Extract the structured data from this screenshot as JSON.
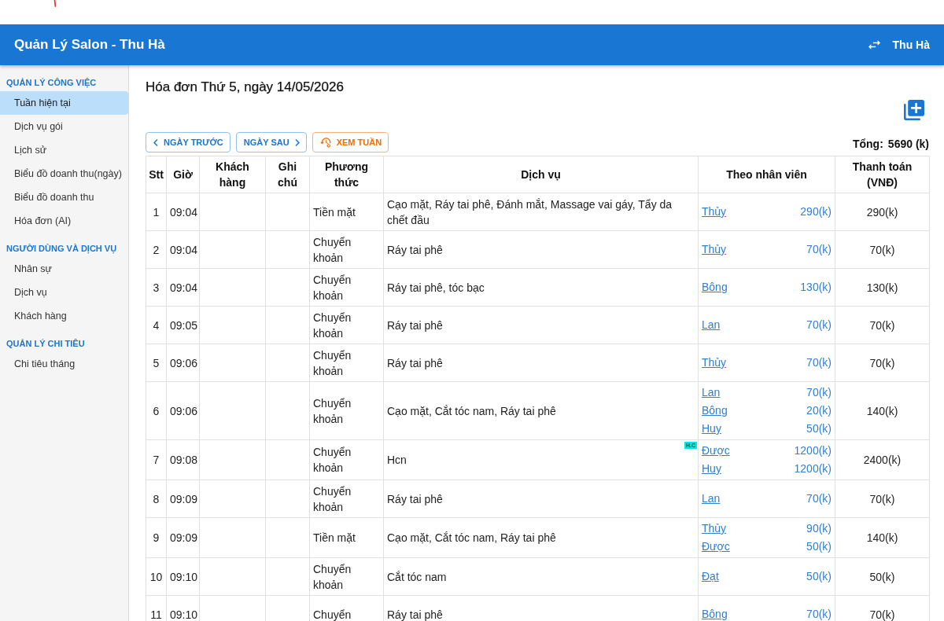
{
  "app_bar": {
    "title": "Quản Lý Salon - Thu Hà",
    "user": "Thu Hà"
  },
  "sidebar": {
    "sections": [
      {
        "heading": "QUẢN LÝ CÔNG VIỆC",
        "items": [
          {
            "label": "Tuần hiện tại",
            "selected": true
          },
          {
            "label": "Dịch vụ gói",
            "selected": false
          },
          {
            "label": "Lịch sử",
            "selected": false
          },
          {
            "label": "Biểu đồ doanh thu(ngày)",
            "selected": false
          },
          {
            "label": "Biểu đồ doanh thu",
            "selected": false
          },
          {
            "label": "Hóa đơn (AI)",
            "selected": false
          }
        ]
      },
      {
        "heading": "NGƯỜI DÙNG VÀ DỊCH VỤ",
        "items": [
          {
            "label": "Nhân sự",
            "selected": false
          },
          {
            "label": "Dịch vụ",
            "selected": false
          },
          {
            "label": "Khách hàng",
            "selected": false
          }
        ]
      },
      {
        "heading": "QUẢN LÝ CHI TIÊU",
        "items": [
          {
            "label": "Chi tiêu tháng",
            "selected": false
          }
        ]
      }
    ]
  },
  "page": {
    "title": "Hóa đơn Thứ 5, ngày 14/05/2026",
    "buttons": [
      {
        "label": "NGÀY TRƯỚC",
        "kind": "prev"
      },
      {
        "label": "NGÀY SAU",
        "kind": "next"
      },
      {
        "label": "XEM TUẦN",
        "kind": "week"
      }
    ],
    "total": {
      "label": "Tổng:",
      "value": "5690 (k)"
    }
  },
  "table": {
    "columns": [
      "Stt",
      "Giờ",
      "Khách hàng",
      "Ghi chú",
      "Phương thức",
      "Dịch vụ",
      "Theo nhân viên",
      "Thanh toán (VNĐ)"
    ],
    "rows": [
      {
        "stt": "1",
        "time": "09:04",
        "method": "Tiền mặt",
        "services": "Cạo mặt, Ráy tai phê, Đánh mắt, Massage vai gáy, Tẩy da chết đầu",
        "staff": [
          {
            "name": "Thủy",
            "amount": "290(k)"
          }
        ],
        "total": "290(k)"
      },
      {
        "stt": "2",
        "time": "09:04",
        "method": "Chuyển khoản",
        "services": "Ráy tai phê",
        "staff": [
          {
            "name": "Thủy",
            "amount": "70(k)"
          }
        ],
        "total": "70(k)"
      },
      {
        "stt": "3",
        "time": "09:04",
        "method": "Chuyển khoản",
        "services": "Ráy tai phê, tóc bạc",
        "staff": [
          {
            "name": "Bông",
            "amount": "130(k)"
          }
        ],
        "total": "130(k)"
      },
      {
        "stt": "4",
        "time": "09:05",
        "method": "Chuyển khoản",
        "services": "Ráy tai phê",
        "staff": [
          {
            "name": "Lan",
            "amount": "70(k)"
          }
        ],
        "total": "70(k)"
      },
      {
        "stt": "5",
        "time": "09:06",
        "method": "Chuyển khoản",
        "services": "Ráy tai phê",
        "staff": [
          {
            "name": "Thủy",
            "amount": "70(k)"
          }
        ],
        "total": "70(k)"
      },
      {
        "stt": "6",
        "time": "09:06",
        "method": "Chuyển khoản",
        "services": "Cạo mặt, Cắt tóc nam, Ráy tai phê",
        "staff": [
          {
            "name": "Lan",
            "amount": "70(k)"
          },
          {
            "name": "Bông",
            "amount": "20(k)"
          },
          {
            "name": "Huy",
            "amount": "50(k)"
          }
        ],
        "total": "140(k)"
      },
      {
        "stt": "7",
        "time": "09:08",
        "method": "Chuyển khoản",
        "services": "Hcn",
        "badge": "H.C",
        "staff": [
          {
            "name": "Được",
            "amount": "1200(k)"
          },
          {
            "name": "Huy",
            "amount": "1200(k)"
          }
        ],
        "total": "2400(k)"
      },
      {
        "stt": "8",
        "time": "09:09",
        "method": "Chuyển khoản",
        "services": "Ráy tai phê",
        "staff": [
          {
            "name": "Lan",
            "amount": "70(k)"
          }
        ],
        "total": "70(k)"
      },
      {
        "stt": "9",
        "time": "09:09",
        "method": "Tiền mặt",
        "services": "Cạo mặt, Cắt tóc nam, Ráy tai phê",
        "staff": [
          {
            "name": "Thủy",
            "amount": "90(k)"
          },
          {
            "name": "Được",
            "amount": "50(k)"
          }
        ],
        "total": "140(k)"
      },
      {
        "stt": "10",
        "time": "09:10",
        "method": "Chuyển khoản",
        "services": "Cắt tóc nam",
        "staff": [
          {
            "name": "Đạt",
            "amount": "50(k)"
          }
        ],
        "total": "50(k)"
      },
      {
        "stt": "11",
        "time": "09:10",
        "method": "Chuyển",
        "services": "Ráy tai phê",
        "staff": [
          {
            "name": "Bông",
            "amount": "70(k)"
          }
        ],
        "total": "70(k)"
      }
    ]
  }
}
